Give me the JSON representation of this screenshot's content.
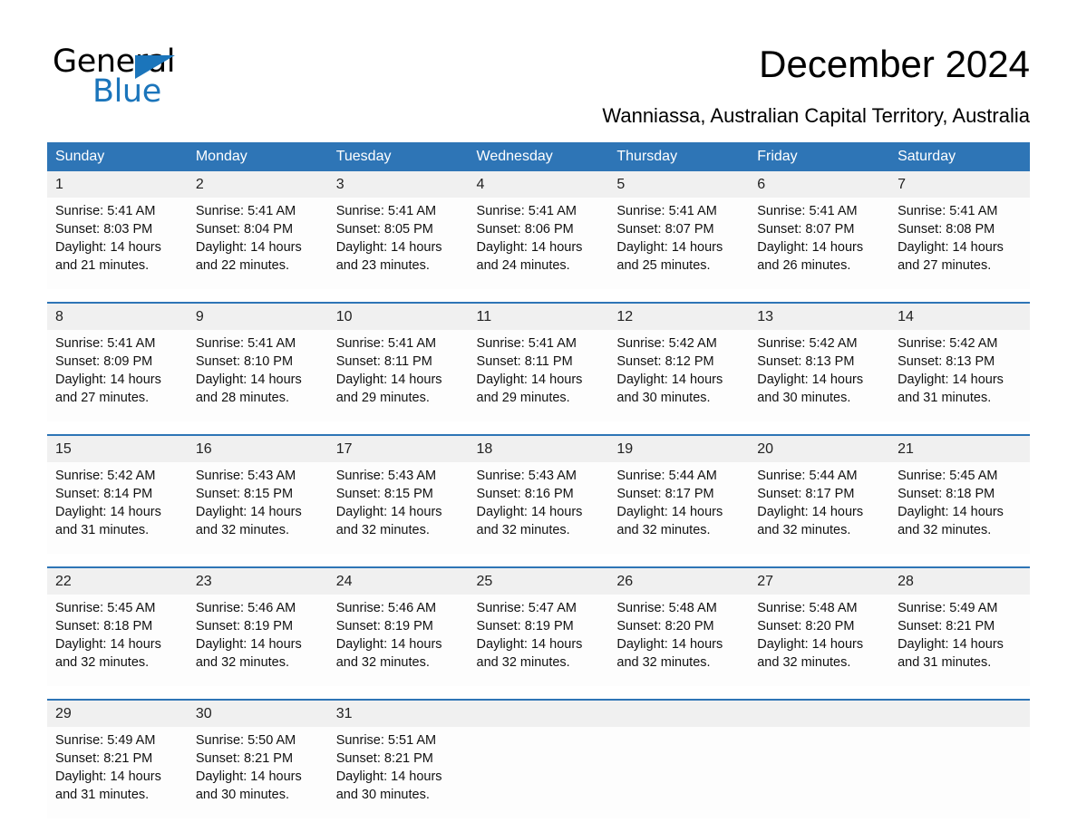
{
  "brand": {
    "name_part1": "General",
    "name_part2": "Blue",
    "accent_color": "#1b75bb"
  },
  "header": {
    "title": "December 2024",
    "location": "Wanniassa, Australian Capital Territory, Australia"
  },
  "calendar": {
    "header_bg": "#2e75b6",
    "daynum_bg": "#f0f0f0",
    "weekday_headers": [
      "Sunday",
      "Monday",
      "Tuesday",
      "Wednesday",
      "Thursday",
      "Friday",
      "Saturday"
    ],
    "weeks": [
      [
        {
          "day": "1",
          "sunrise": "Sunrise: 5:41 AM",
          "sunset": "Sunset: 8:03 PM",
          "daylight_1": "Daylight: 14 hours",
          "daylight_2": "and 21 minutes."
        },
        {
          "day": "2",
          "sunrise": "Sunrise: 5:41 AM",
          "sunset": "Sunset: 8:04 PM",
          "daylight_1": "Daylight: 14 hours",
          "daylight_2": "and 22 minutes."
        },
        {
          "day": "3",
          "sunrise": "Sunrise: 5:41 AM",
          "sunset": "Sunset: 8:05 PM",
          "daylight_1": "Daylight: 14 hours",
          "daylight_2": "and 23 minutes."
        },
        {
          "day": "4",
          "sunrise": "Sunrise: 5:41 AM",
          "sunset": "Sunset: 8:06 PM",
          "daylight_1": "Daylight: 14 hours",
          "daylight_2": "and 24 minutes."
        },
        {
          "day": "5",
          "sunrise": "Sunrise: 5:41 AM",
          "sunset": "Sunset: 8:07 PM",
          "daylight_1": "Daylight: 14 hours",
          "daylight_2": "and 25 minutes."
        },
        {
          "day": "6",
          "sunrise": "Sunrise: 5:41 AM",
          "sunset": "Sunset: 8:07 PM",
          "daylight_1": "Daylight: 14 hours",
          "daylight_2": "and 26 minutes."
        },
        {
          "day": "7",
          "sunrise": "Sunrise: 5:41 AM",
          "sunset": "Sunset: 8:08 PM",
          "daylight_1": "Daylight: 14 hours",
          "daylight_2": "and 27 minutes."
        }
      ],
      [
        {
          "day": "8",
          "sunrise": "Sunrise: 5:41 AM",
          "sunset": "Sunset: 8:09 PM",
          "daylight_1": "Daylight: 14 hours",
          "daylight_2": "and 27 minutes."
        },
        {
          "day": "9",
          "sunrise": "Sunrise: 5:41 AM",
          "sunset": "Sunset: 8:10 PM",
          "daylight_1": "Daylight: 14 hours",
          "daylight_2": "and 28 minutes."
        },
        {
          "day": "10",
          "sunrise": "Sunrise: 5:41 AM",
          "sunset": "Sunset: 8:11 PM",
          "daylight_1": "Daylight: 14 hours",
          "daylight_2": "and 29 minutes."
        },
        {
          "day": "11",
          "sunrise": "Sunrise: 5:41 AM",
          "sunset": "Sunset: 8:11 PM",
          "daylight_1": "Daylight: 14 hours",
          "daylight_2": "and 29 minutes."
        },
        {
          "day": "12",
          "sunrise": "Sunrise: 5:42 AM",
          "sunset": "Sunset: 8:12 PM",
          "daylight_1": "Daylight: 14 hours",
          "daylight_2": "and 30 minutes."
        },
        {
          "day": "13",
          "sunrise": "Sunrise: 5:42 AM",
          "sunset": "Sunset: 8:13 PM",
          "daylight_1": "Daylight: 14 hours",
          "daylight_2": "and 30 minutes."
        },
        {
          "day": "14",
          "sunrise": "Sunrise: 5:42 AM",
          "sunset": "Sunset: 8:13 PM",
          "daylight_1": "Daylight: 14 hours",
          "daylight_2": "and 31 minutes."
        }
      ],
      [
        {
          "day": "15",
          "sunrise": "Sunrise: 5:42 AM",
          "sunset": "Sunset: 8:14 PM",
          "daylight_1": "Daylight: 14 hours",
          "daylight_2": "and 31 minutes."
        },
        {
          "day": "16",
          "sunrise": "Sunrise: 5:43 AM",
          "sunset": "Sunset: 8:15 PM",
          "daylight_1": "Daylight: 14 hours",
          "daylight_2": "and 32 minutes."
        },
        {
          "day": "17",
          "sunrise": "Sunrise: 5:43 AM",
          "sunset": "Sunset: 8:15 PM",
          "daylight_1": "Daylight: 14 hours",
          "daylight_2": "and 32 minutes."
        },
        {
          "day": "18",
          "sunrise": "Sunrise: 5:43 AM",
          "sunset": "Sunset: 8:16 PM",
          "daylight_1": "Daylight: 14 hours",
          "daylight_2": "and 32 minutes."
        },
        {
          "day": "19",
          "sunrise": "Sunrise: 5:44 AM",
          "sunset": "Sunset: 8:17 PM",
          "daylight_1": "Daylight: 14 hours",
          "daylight_2": "and 32 minutes."
        },
        {
          "day": "20",
          "sunrise": "Sunrise: 5:44 AM",
          "sunset": "Sunset: 8:17 PM",
          "daylight_1": "Daylight: 14 hours",
          "daylight_2": "and 32 minutes."
        },
        {
          "day": "21",
          "sunrise": "Sunrise: 5:45 AM",
          "sunset": "Sunset: 8:18 PM",
          "daylight_1": "Daylight: 14 hours",
          "daylight_2": "and 32 minutes."
        }
      ],
      [
        {
          "day": "22",
          "sunrise": "Sunrise: 5:45 AM",
          "sunset": "Sunset: 8:18 PM",
          "daylight_1": "Daylight: 14 hours",
          "daylight_2": "and 32 minutes."
        },
        {
          "day": "23",
          "sunrise": "Sunrise: 5:46 AM",
          "sunset": "Sunset: 8:19 PM",
          "daylight_1": "Daylight: 14 hours",
          "daylight_2": "and 32 minutes."
        },
        {
          "day": "24",
          "sunrise": "Sunrise: 5:46 AM",
          "sunset": "Sunset: 8:19 PM",
          "daylight_1": "Daylight: 14 hours",
          "daylight_2": "and 32 minutes."
        },
        {
          "day": "25",
          "sunrise": "Sunrise: 5:47 AM",
          "sunset": "Sunset: 8:19 PM",
          "daylight_1": "Daylight: 14 hours",
          "daylight_2": "and 32 minutes."
        },
        {
          "day": "26",
          "sunrise": "Sunrise: 5:48 AM",
          "sunset": "Sunset: 8:20 PM",
          "daylight_1": "Daylight: 14 hours",
          "daylight_2": "and 32 minutes."
        },
        {
          "day": "27",
          "sunrise": "Sunrise: 5:48 AM",
          "sunset": "Sunset: 8:20 PM",
          "daylight_1": "Daylight: 14 hours",
          "daylight_2": "and 32 minutes."
        },
        {
          "day": "28",
          "sunrise": "Sunrise: 5:49 AM",
          "sunset": "Sunset: 8:21 PM",
          "daylight_1": "Daylight: 14 hours",
          "daylight_2": "and 31 minutes."
        }
      ],
      [
        {
          "day": "29",
          "sunrise": "Sunrise: 5:49 AM",
          "sunset": "Sunset: 8:21 PM",
          "daylight_1": "Daylight: 14 hours",
          "daylight_2": "and 31 minutes."
        },
        {
          "day": "30",
          "sunrise": "Sunrise: 5:50 AM",
          "sunset": "Sunset: 8:21 PM",
          "daylight_1": "Daylight: 14 hours",
          "daylight_2": "and 30 minutes."
        },
        {
          "day": "31",
          "sunrise": "Sunrise: 5:51 AM",
          "sunset": "Sunset: 8:21 PM",
          "daylight_1": "Daylight: 14 hours",
          "daylight_2": "and 30 minutes."
        },
        {
          "day": "",
          "sunrise": "",
          "sunset": "",
          "daylight_1": "",
          "daylight_2": ""
        },
        {
          "day": "",
          "sunrise": "",
          "sunset": "",
          "daylight_1": "",
          "daylight_2": ""
        },
        {
          "day": "",
          "sunrise": "",
          "sunset": "",
          "daylight_1": "",
          "daylight_2": ""
        },
        {
          "day": "",
          "sunrise": "",
          "sunset": "",
          "daylight_1": "",
          "daylight_2": ""
        }
      ]
    ]
  }
}
